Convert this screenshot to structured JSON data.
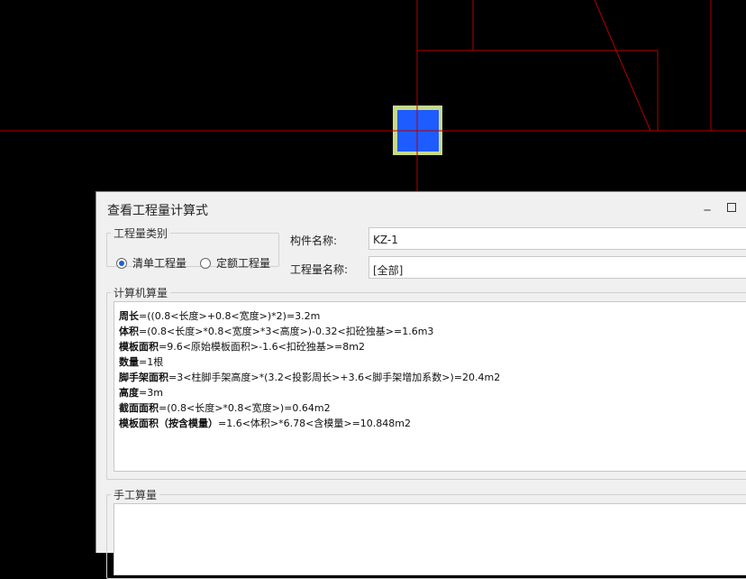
{
  "canvas": {
    "background": "#000000",
    "line_color": "#b30000",
    "column_fill": "#1e5cff",
    "column_border": "#c8d98a"
  },
  "dialog": {
    "title": "查看工程量计算式",
    "minimize_label": "_",
    "category_legend": "工程量类别",
    "radio_list": "清单工程量",
    "radio_quota": "定额工程量",
    "component_name_label": "构件名称:",
    "component_name_value": "KZ-1",
    "quantity_name_label": "工程量名称:",
    "quantity_name_value": "[全部]",
    "computer_legend": "计算机算量",
    "lines": [
      {
        "name": "周长",
        "formula": "=((0.8<长度>+0.8<宽度>)*2)=3.2m"
      },
      {
        "name": "体积",
        "formula": "=(0.8<长度>*0.8<宽度>*3<高度>)-0.32<扣砼独基>=1.6m3"
      },
      {
        "name": "模板面积",
        "formula": "=9.6<原始模板面积>-1.6<扣砼独基>=8m2"
      },
      {
        "name": "数量",
        "formula": "=1根"
      },
      {
        "name": "脚手架面积",
        "formula": "=3<柱脚手架高度>*(3.2<投影周长>+3.6<脚手架增加系数>)=20.4m2"
      },
      {
        "name": "高度",
        "formula": "=3m"
      },
      {
        "name": "截面面积",
        "formula": "=(0.8<长度>*0.8<宽度>)=0.64m2"
      },
      {
        "name": "模板面积（按含模量）",
        "formula": "=1.6<体积>*6.78<含模量>=10.848m2"
      }
    ],
    "manual_legend": "手工算量"
  }
}
